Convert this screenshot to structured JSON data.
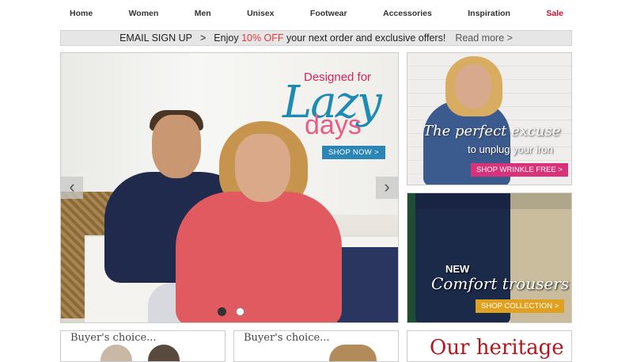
{
  "nav": {
    "items": [
      "Home",
      "Women",
      "Men",
      "Unisex",
      "Footwear",
      "Accessories",
      "Inspiration",
      "Sale"
    ]
  },
  "promo": {
    "signup": "EMAIL SIGN UP",
    "sep": ">",
    "pre": "Enjoy",
    "offer": "10% OFF",
    "post": "your next order and exclusive offers!",
    "read_more": "Read more >"
  },
  "hero": {
    "tagline_top": "Designed for",
    "tagline_main": "Lazy",
    "tagline_sub": "days",
    "cta": "SHOP NOW >",
    "arrow_left": "‹",
    "arrow_right": "›",
    "slides_total": 2,
    "slide_active": 1
  },
  "banner_shirt": {
    "headline": "The perfect excuse",
    "subline": "to unplug your iron",
    "cta": "SHOP WRINKLE FREE >"
  },
  "banner_trousers": {
    "label_new": "NEW",
    "headline": "Comfort trousers",
    "cta": "SHOP COLLECTION >"
  },
  "bottom": {
    "card1_title": "Buyer's choice...",
    "card2_title": "Buyer's choice...",
    "card3_title": "Our heritage"
  },
  "colors": {
    "sale": "#c8102e",
    "promo_accent": "#e03a3e",
    "hero_cta": "#2b86b6",
    "shirt_cta": "#d8327a",
    "trousers_cta": "#e0a020",
    "heritage": "#b3181f"
  }
}
